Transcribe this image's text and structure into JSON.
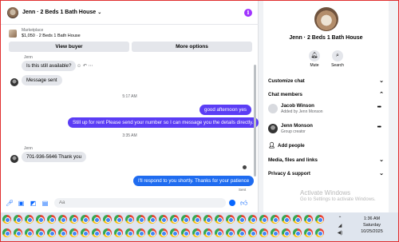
{
  "chat": {
    "title": "Jenn · 2 Beds 1 Bath House",
    "title_chevron": "⌄",
    "marketplace_label": "Marketplace",
    "listing": "$1,050 · 2 Beds 1 Bath House",
    "view_buyer": "View buyer",
    "more_options": "More options",
    "composer_placeholder": "Aa"
  },
  "messages": {
    "sender1": "Jenn",
    "msg1": "Is this still available?",
    "msg2": "Message sent",
    "time1": "5:17 AM",
    "out1": "good afternoon  yes",
    "out2": "Still up for rent Please send your number so I can message you the details directly.",
    "time2": "3:35 AM",
    "sender2": "Jenn",
    "msg3": "701-936-5646 Thank you",
    "out3": "I'll respond to you shortly. Thanks for your patience",
    "sent_label": "Sent"
  },
  "info": {
    "title": "Jenn · 2 Beds 1 Bath House",
    "mute": "Mute",
    "search": "Search",
    "customize": "Customize chat",
    "members": "Chat members",
    "member1_name": "Jacob Winson",
    "member1_sub": "Added by Jenn Monson",
    "member2_name": "Jenn Monson",
    "member2_sub": "Group creator",
    "add_people": "Add people",
    "media": "Media, files and links",
    "privacy": "Privacy & support"
  },
  "watermark": {
    "line1": "Activate Windows",
    "line2": "Go to Settings to activate Windows."
  },
  "taskbar": {
    "time": "1:36 AM",
    "day": "Saturday",
    "date": "10/25/2025"
  },
  "colors": {
    "accent_purple": "#5b3df5",
    "accent_blue": "#1f6cf0",
    "info_icon": "#a033ff"
  }
}
